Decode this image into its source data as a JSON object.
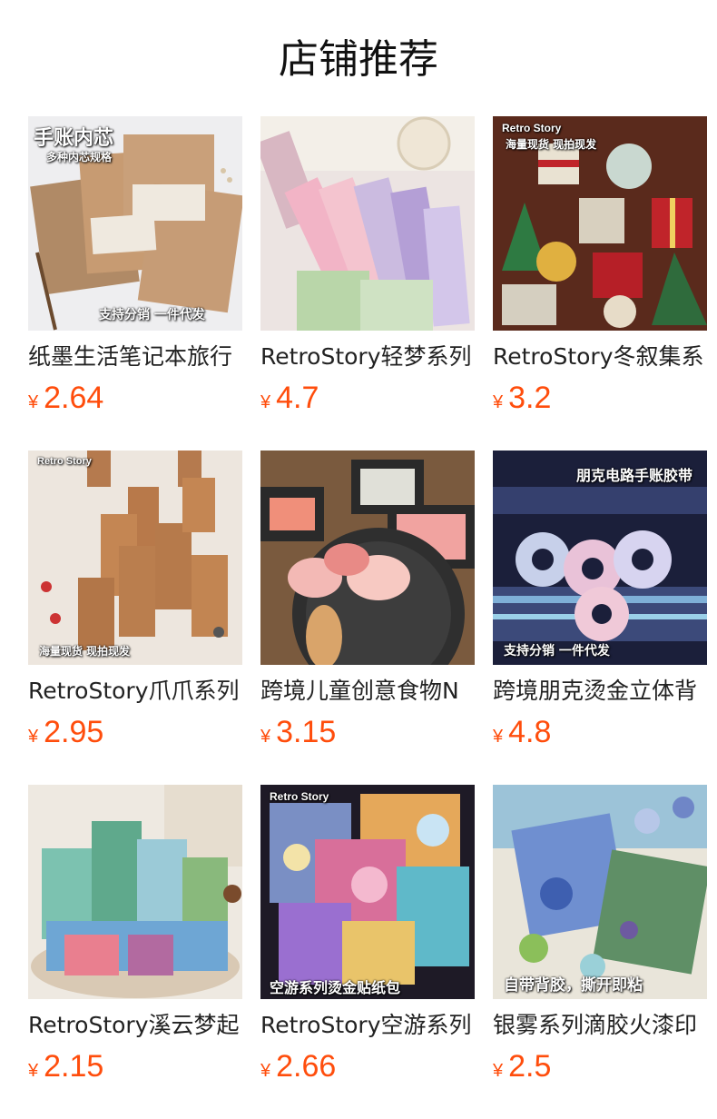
{
  "header": {
    "title": "店铺推荐"
  },
  "currency_symbol": "¥",
  "price_color": "#ff4d0c",
  "products": [
    {
      "name": "纸墨生活笔记本旅行",
      "price": "2.64",
      "image_badges": [
        "手账内芯",
        "多种内芯规格",
        "支持分销   一件代发"
      ]
    },
    {
      "name": "RetroStory轻梦系列",
      "price": "4.7",
      "image_badges": []
    },
    {
      "name": "RetroStory冬叙集系",
      "price": "3.2",
      "image_badges": [
        "Retro Story",
        "海量现货 现拍现发"
      ]
    },
    {
      "name": "RetroStory爪爪系列",
      "price": "2.95",
      "image_badges": [
        "Retro Story",
        "海量现货 现拍现发"
      ]
    },
    {
      "name": "跨境儿童创意食物N",
      "price": "3.15",
      "image_badges": []
    },
    {
      "name": "跨境朋克烫金立体背",
      "price": "4.8",
      "image_badges": [
        "朋克电路手账胶带",
        "支持分销   一件代发"
      ]
    },
    {
      "name": "RetroStory溪云梦起",
      "price": "2.15",
      "image_badges": []
    },
    {
      "name": "RetroStory空游系列",
      "price": "2.66",
      "image_badges": [
        "Retro Story",
        "空游系列烫金贴纸包"
      ]
    },
    {
      "name": "银雾系列滴胶火漆印",
      "price": "2.5",
      "image_badges": [
        "自带背胶，撕开即粘"
      ]
    }
  ]
}
